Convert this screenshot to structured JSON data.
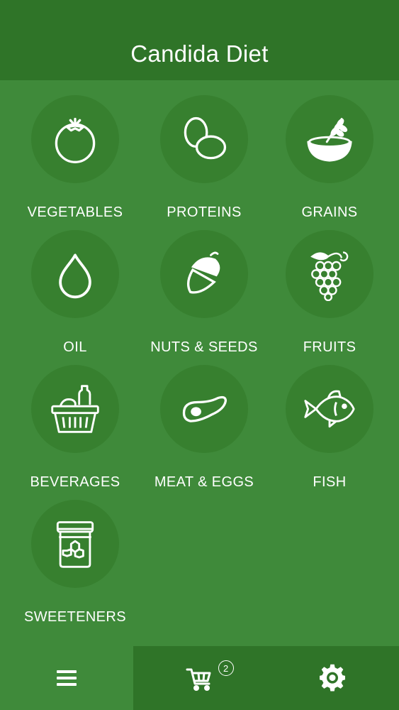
{
  "header": {
    "title": "Candida Diet"
  },
  "categories": [
    {
      "label": "VEGETABLES",
      "icon": "tomato-icon"
    },
    {
      "label": "PROTEINS",
      "icon": "eggs-icon"
    },
    {
      "label": "GRAINS",
      "icon": "grain-bowl-icon"
    },
    {
      "label": "OIL",
      "icon": "drop-icon"
    },
    {
      "label": "NUTS & SEEDS",
      "icon": "acorn-icon"
    },
    {
      "label": "FRUITS",
      "icon": "grapes-icon"
    },
    {
      "label": "BEVERAGES",
      "icon": "basket-icon"
    },
    {
      "label": "MEAT & EGGS",
      "icon": "steak-icon"
    },
    {
      "label": "FISH",
      "icon": "fish-icon"
    },
    {
      "label": "SWEETENERS",
      "icon": "honey-jar-icon"
    }
  ],
  "tabbar": {
    "menu_icon": "hamburger-menu-icon",
    "cart_icon": "shopping-cart-icon",
    "cart_count": "2",
    "settings_icon": "gear-icon",
    "active_tab": "menu"
  },
  "colors": {
    "background": "#3f8a3a",
    "header": "#2f7428",
    "circle": "#37802f",
    "text": "#ffffff"
  }
}
